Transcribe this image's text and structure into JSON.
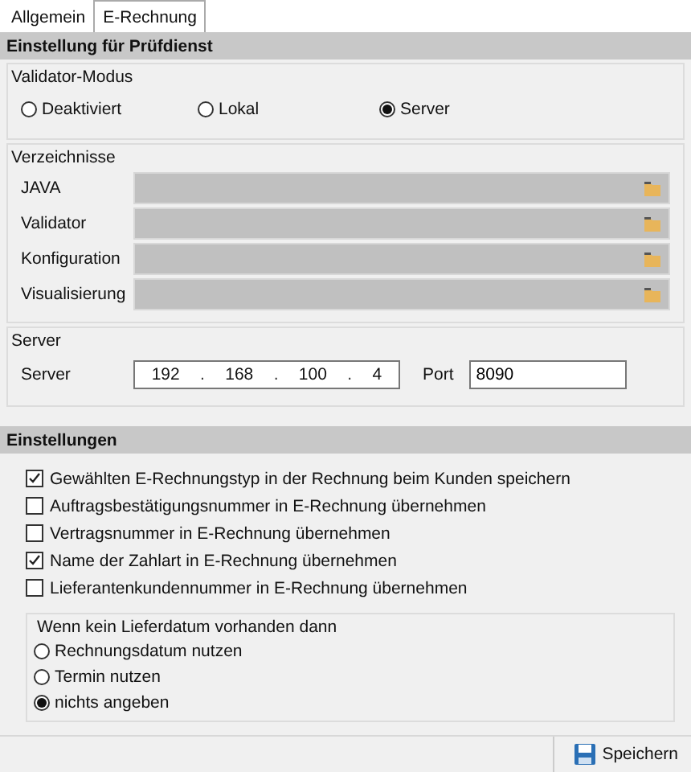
{
  "tabs": [
    {
      "label": "Allgemein",
      "selected": false
    },
    {
      "label": "E-Rechnung",
      "selected": true
    }
  ],
  "pruefdienst": {
    "title": "Einstellung für Prüfdienst",
    "validator_modus": {
      "title": "Validator-Modus",
      "options": [
        {
          "label": "Deaktiviert",
          "selected": false
        },
        {
          "label": "Lokal",
          "selected": false
        },
        {
          "label": "Server",
          "selected": true
        }
      ]
    },
    "verzeichnisse": {
      "title": "Verzeichnisse",
      "fields": [
        {
          "label": "JAVA"
        },
        {
          "label": "Validator"
        },
        {
          "label": "Konfiguration"
        },
        {
          "label": "Visualisierung"
        }
      ]
    },
    "server": {
      "title": "Server",
      "label": "Server",
      "ip": [
        "192",
        ".",
        "168",
        ".",
        "100",
        ".",
        "4"
      ],
      "port_label": "Port",
      "port": "8090"
    }
  },
  "einstellungen": {
    "title": "Einstellungen",
    "checkboxes": [
      {
        "label": "Gewählten E-Rechnungstyp in der Rechnung  beim Kunden speichern",
        "checked": true
      },
      {
        "label": "Auftragsbestätigungsnummer in E-Rechnung übernehmen",
        "checked": false
      },
      {
        "label": "Vertragsnummer in E-Rechnung übernehmen",
        "checked": false
      },
      {
        "label": "Name der Zahlart in E-Rechnung übernehmen",
        "checked": true
      },
      {
        "label": "Lieferantenkundennummer in E-Rechnung übernehmen",
        "checked": false
      }
    ],
    "lieferdatum": {
      "title": "Wenn kein Lieferdatum vorhanden dann",
      "options": [
        {
          "label": "Rechnungsdatum nutzen",
          "selected": false
        },
        {
          "label": "Termin nutzen",
          "selected": false
        },
        {
          "label": "nichts angeben",
          "selected": true
        }
      ]
    }
  },
  "save_button": "Speichern"
}
